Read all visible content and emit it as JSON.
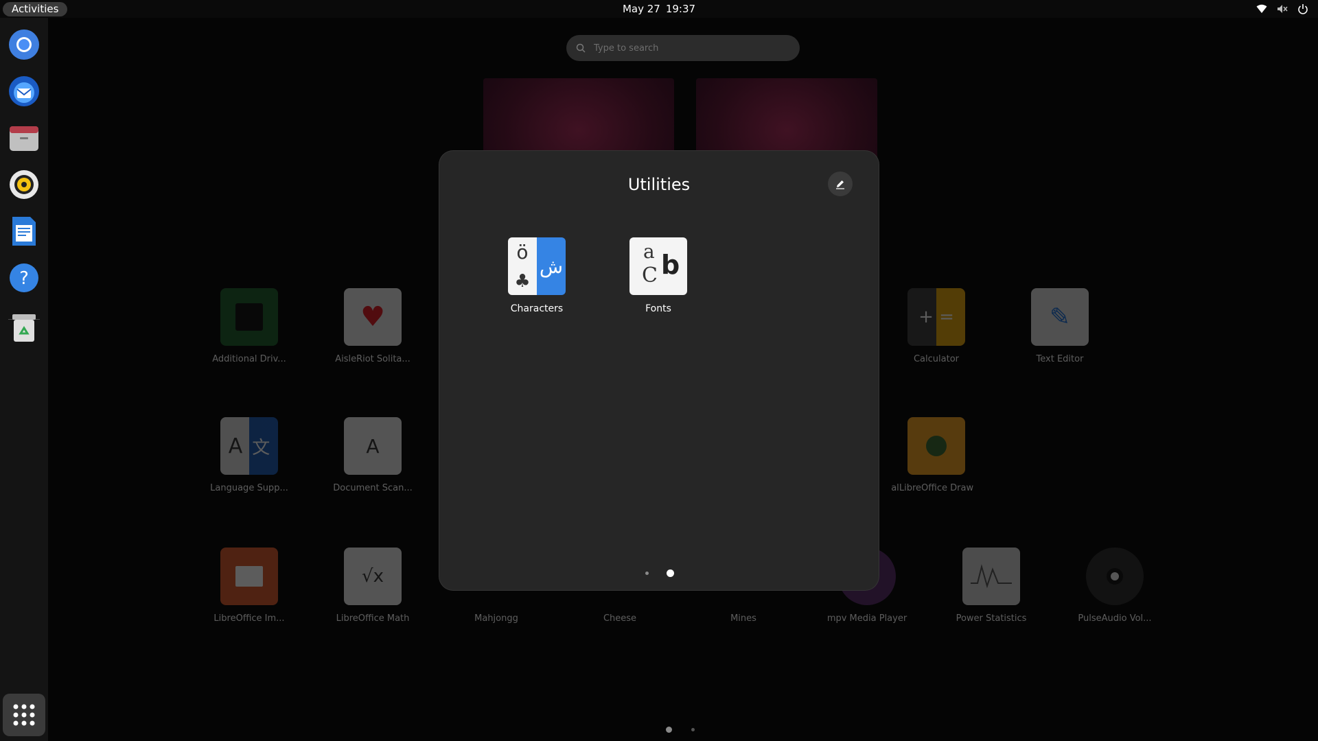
{
  "topbar": {
    "activities_label": "Activities",
    "date": "May 27",
    "time": "19:37"
  },
  "dock": {
    "apps": [
      {
        "name": "Chromium",
        "icon": "chromium-icon"
      },
      {
        "name": "Thunderbird",
        "icon": "thunderbird-icon"
      },
      {
        "name": "Files",
        "icon": "files-icon"
      },
      {
        "name": "Rhythmbox",
        "icon": "rhythmbox-icon"
      },
      {
        "name": "LibreOffice Writer",
        "icon": "writer-icon"
      },
      {
        "name": "Help",
        "icon": "help-icon"
      },
      {
        "name": "Trash",
        "icon": "trash-icon"
      }
    ],
    "show_apps_icon": "grid-icon"
  },
  "search": {
    "placeholder": "Type to search"
  },
  "background_apps": [
    {
      "label": "Additional Driv..."
    },
    {
      "label": "AisleRiot Solita..."
    },
    {
      "label": "Calculator"
    },
    {
      "label": "Text Editor"
    },
    {
      "label": "Language Supp..."
    },
    {
      "label": "Document Scan..."
    },
    {
      "label": "al"
    },
    {
      "label": "LibreOffice Draw"
    },
    {
      "label": "LibreOffice Im..."
    },
    {
      "label": "LibreOffice Math"
    },
    {
      "label": "Mahjongg"
    },
    {
      "label": "Cheese"
    },
    {
      "label": "Mines"
    },
    {
      "label": "mpv Media Player"
    },
    {
      "label": "Power Statistics"
    },
    {
      "label": "PulseAudio Vol..."
    }
  ],
  "folder": {
    "title": "Utilities",
    "apps": [
      {
        "label": "Characters",
        "glyph_top": "ö",
        "glyph_right": "ش",
        "glyph_bottom": "♣"
      },
      {
        "label": "Fonts",
        "glyph_a": "a",
        "glyph_b": "b",
        "glyph_c": "C"
      }
    ],
    "page_count": 2,
    "active_page": 2
  },
  "colors": {
    "accent_blue": "#3584e4",
    "folder_bg": "#262626"
  }
}
